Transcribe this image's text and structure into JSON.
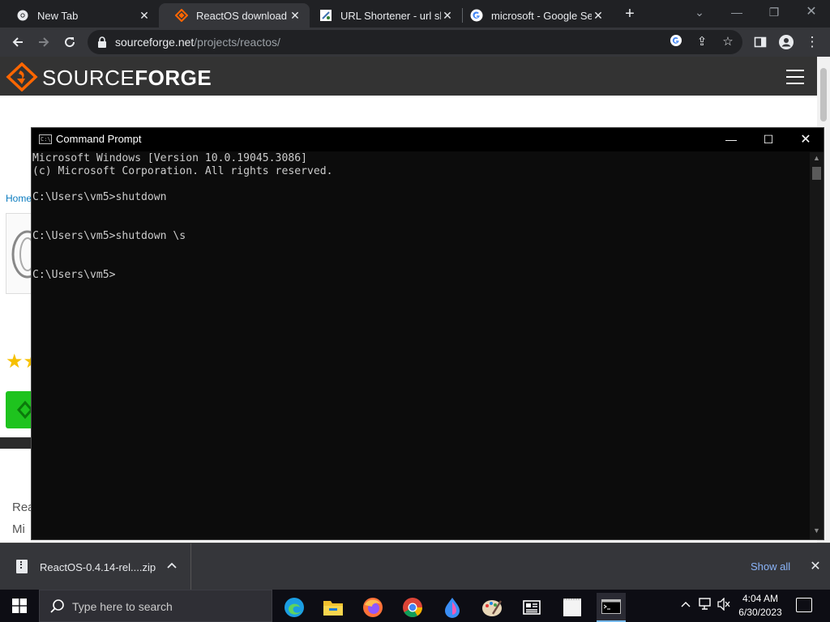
{
  "browser": {
    "tabs": [
      {
        "title": "New Tab",
        "active": false
      },
      {
        "title": "ReactOS download | So",
        "active": true
      },
      {
        "title": "URL Shortener - url sho",
        "active": false
      },
      {
        "title": "microsoft - Google Sea",
        "active": false
      }
    ],
    "new_tab_symbol": "+",
    "address": {
      "host": "sourceforge.net",
      "path": "/projects/reactos/"
    }
  },
  "page": {
    "logo": {
      "part1": "SOURCE",
      "part2": "FORGE"
    },
    "breadcrumb_home": "Home",
    "stars": "★★",
    "fragment_1": "Rea",
    "fragment_2": "Mi"
  },
  "cmd": {
    "title": "Command Prompt",
    "lines": [
      "Microsoft Windows [Version 10.0.19045.3086]",
      "(c) Microsoft Corporation. All rights reserved.",
      "",
      "C:\\Users\\vm5>shutdown",
      "",
      "",
      "C:\\Users\\vm5>shutdown \\s",
      "",
      "",
      "C:\\Users\\vm5>"
    ]
  },
  "downloads": {
    "file_name": "ReactOS-0.4.14-rel....zip",
    "show_all": "Show all"
  },
  "taskbar": {
    "search_placeholder": "Type here to search",
    "time": "4:04 AM",
    "date": "6/30/2023"
  },
  "colors": {
    "sourceforge_orange": "#ff6600",
    "chrome_dark": "#35363a",
    "cmd_bg": "#0c0c0c",
    "cmd_text": "#cccccc",
    "link_blue": "#8ab4f8",
    "download_green": "#1ec31e"
  }
}
